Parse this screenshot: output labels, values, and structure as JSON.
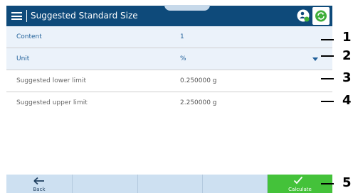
{
  "header": {
    "title": "Suggested Standard Size",
    "menu_icon": "hamburger-menu-icon",
    "user_icon": "user-status-icon",
    "sync_icon": "sync-icon",
    "color": "#0e4a7a"
  },
  "rows": [
    {
      "label": "Content",
      "value": "1",
      "highlighted": true
    },
    {
      "label": "Unit",
      "value": "%",
      "highlighted": true,
      "dropdown": true
    },
    {
      "label": "Suggested lower limit",
      "value": "0.250000 g",
      "highlighted": false
    },
    {
      "label": "Suggested upper limit",
      "value": "2.250000 g",
      "highlighted": false
    }
  ],
  "footer": {
    "back_label": "Back",
    "back_icon": "arrow-left-icon",
    "calculate_label": "Calculate",
    "calculate_icon": "checkmark-icon",
    "calculate_color": "#44c23a"
  },
  "callouts": [
    "1",
    "2",
    "3",
    "4",
    "5"
  ]
}
